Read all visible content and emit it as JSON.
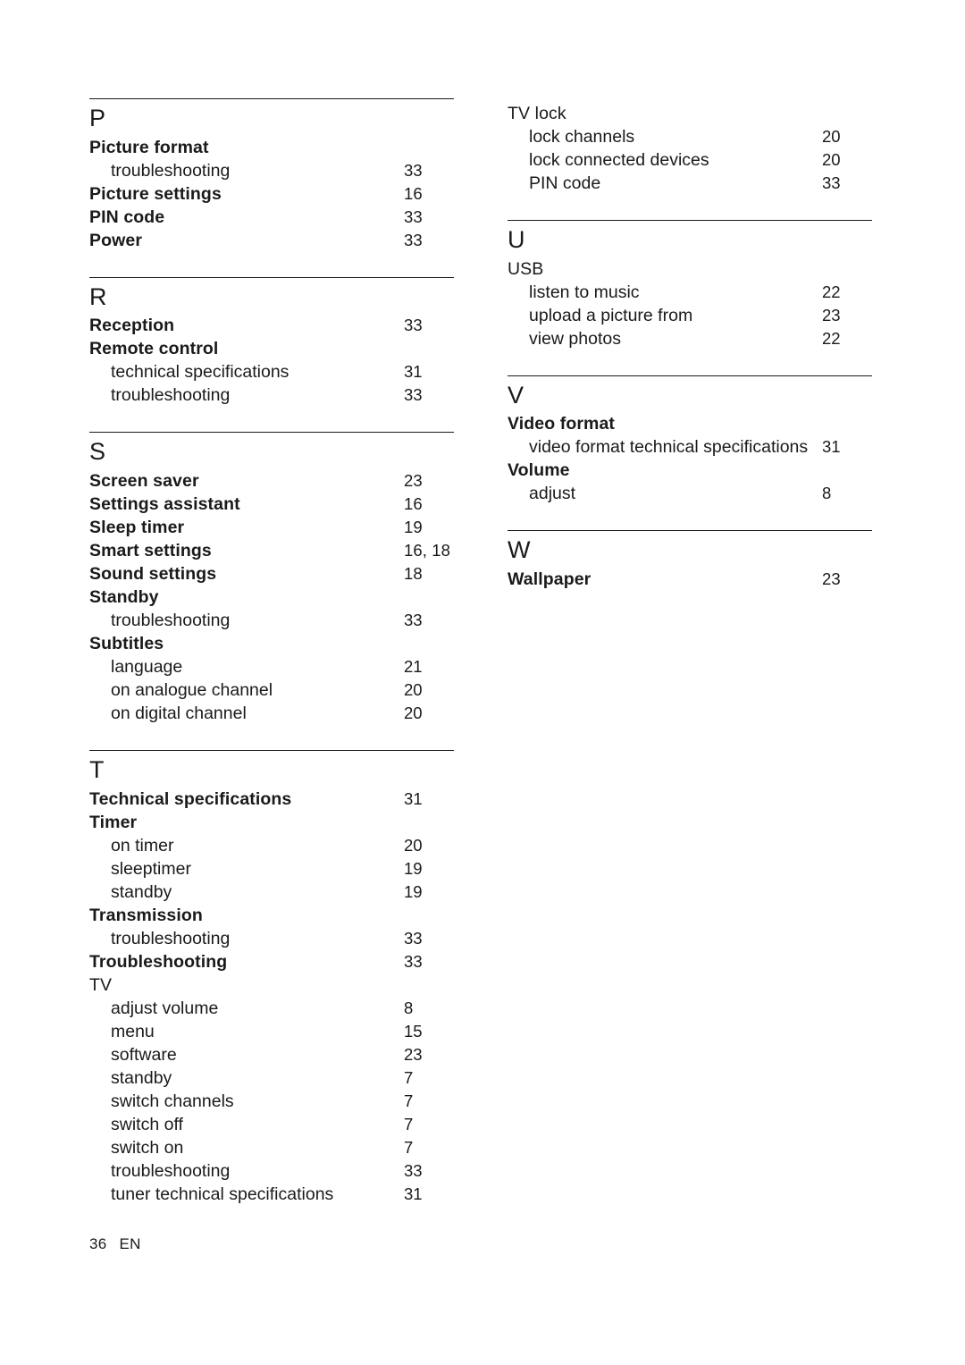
{
  "document": {
    "footer_page": "36",
    "footer_lang": "EN"
  },
  "left_column": [
    {
      "letter": "P",
      "entries": [
        {
          "label": "Picture format",
          "page": "",
          "level": 0
        },
        {
          "label": "troubleshooting",
          "page": "33",
          "level": 1
        },
        {
          "label": "Picture settings",
          "page": "16",
          "level": 0
        },
        {
          "label": "PIN code",
          "page": "33",
          "level": 0
        },
        {
          "label": "Power",
          "page": "33",
          "level": 0
        }
      ]
    },
    {
      "letter": "R",
      "entries": [
        {
          "label": "Reception",
          "page": "33",
          "level": 0
        },
        {
          "label": "Remote control",
          "page": "",
          "level": 0
        },
        {
          "label": "technical specifications",
          "page": "31",
          "level": 1
        },
        {
          "label": "troubleshooting",
          "page": "33",
          "level": 1
        }
      ]
    },
    {
      "letter": "S",
      "entries": [
        {
          "label": "Screen saver",
          "page": "23",
          "level": 0
        },
        {
          "label": "Settings assistant",
          "page": "16",
          "level": 0
        },
        {
          "label": "Sleep timer",
          "page": "19",
          "level": 0
        },
        {
          "label": "Smart settings",
          "page": "16, 18",
          "level": 0
        },
        {
          "label": "Sound settings",
          "page": "18",
          "level": 0
        },
        {
          "label": "Standby",
          "page": "",
          "level": 0
        },
        {
          "label": "troubleshooting",
          "page": "33",
          "level": 1
        },
        {
          "label": "Subtitles",
          "page": "",
          "level": 0
        },
        {
          "label": "language",
          "page": "21",
          "level": 1
        },
        {
          "label": "on analogue channel",
          "page": "20",
          "level": 1
        },
        {
          "label": "on digital channel",
          "page": "20",
          "level": 1
        }
      ]
    },
    {
      "letter": "T",
      "entries": [
        {
          "label": "Technical specifications",
          "page": "31",
          "level": 0
        },
        {
          "label": "Timer",
          "page": "",
          "level": 0
        },
        {
          "label": "on timer",
          "page": "20",
          "level": 1
        },
        {
          "label": "sleeptimer",
          "page": "19",
          "level": 1
        },
        {
          "label": "standby",
          "page": "19",
          "level": 1
        },
        {
          "label": "Transmission",
          "page": "",
          "level": 0
        },
        {
          "label": "troubleshooting",
          "page": "33",
          "level": 1
        },
        {
          "label": "Troubleshooting",
          "page": "33",
          "level": 0
        },
        {
          "label": "TV",
          "page": "",
          "level": 0,
          "plain": true
        },
        {
          "label": "adjust volume",
          "page": "8",
          "level": 1
        },
        {
          "label": "menu",
          "page": "15",
          "level": 1
        },
        {
          "label": "software",
          "page": "23",
          "level": 1
        },
        {
          "label": "standby",
          "page": "7",
          "level": 1
        },
        {
          "label": "switch channels",
          "page": "7",
          "level": 1
        },
        {
          "label": "switch off",
          "page": "7",
          "level": 1
        },
        {
          "label": "switch on",
          "page": "7",
          "level": 1
        },
        {
          "label": "troubleshooting",
          "page": "33",
          "level": 1
        },
        {
          "label": "tuner technical specifications",
          "page": "31",
          "level": 1
        }
      ]
    }
  ],
  "right_column": [
    {
      "letter": "",
      "entries": [
        {
          "label": "TV lock",
          "page": "",
          "level": 0,
          "plain": true
        },
        {
          "label": "lock channels",
          "page": "20",
          "level": 1
        },
        {
          "label": "lock connected devices",
          "page": "20",
          "level": 1
        },
        {
          "label": "PIN code",
          "page": "33",
          "level": 1
        }
      ]
    },
    {
      "letter": "U",
      "entries": [
        {
          "label": "USB",
          "page": "",
          "level": 0,
          "plain": true
        },
        {
          "label": "listen to music",
          "page": "22",
          "level": 1
        },
        {
          "label": "upload a picture from",
          "page": "23",
          "level": 1
        },
        {
          "label": "view photos",
          "page": "22",
          "level": 1
        }
      ]
    },
    {
      "letter": "V",
      "entries": [
        {
          "label": "Video format",
          "page": "",
          "level": 0
        },
        {
          "label": "video format technical specifications",
          "page": "31",
          "level": 1
        },
        {
          "label": "Volume",
          "page": "",
          "level": 0
        },
        {
          "label": "adjust",
          "page": "8",
          "level": 1
        }
      ]
    },
    {
      "letter": "W",
      "entries": [
        {
          "label": "Wallpaper",
          "page": "23",
          "level": 0
        }
      ]
    }
  ]
}
